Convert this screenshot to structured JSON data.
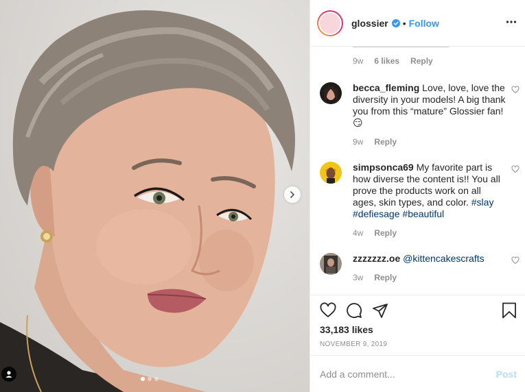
{
  "post": {
    "photo_description_icon": "portrait-photo",
    "carousel": {
      "current": 1,
      "total": 3
    }
  },
  "header": {
    "username": "glossier",
    "separator": "•",
    "follow_label": "Follow",
    "verified_icon": "verified-badge-icon",
    "more_icon": "more-options-icon"
  },
  "truncated_comment": {
    "time": "9w",
    "likes": "6 likes",
    "reply": "Reply"
  },
  "comments": [
    {
      "username": "becca_fleming",
      "text": "Love, love, love the diversity in your models! A big thank you from this “mature” Glossier fan! 😏",
      "time": "9w",
      "reply": "Reply"
    },
    {
      "username": "simpsonca69",
      "text": "My favorite part is how diverse the content is!! You all prove the products work on all ages, skin types, and color.",
      "tags": [
        "#slay",
        "#defiesage",
        "#beautiful"
      ],
      "time": "4w",
      "reply": "Reply"
    },
    {
      "username": "zzzzzzz.oe",
      "mention": "@kittencakescrafts",
      "time": "3w",
      "reply": "Reply"
    }
  ],
  "actions": {
    "likes": "33,183 likes",
    "date": "NOVEMBER 9, 2019",
    "icons": [
      "heart-icon",
      "comment-icon",
      "share-icon",
      "bookmark-icon"
    ]
  },
  "add_comment": {
    "placeholder": "Add a comment...",
    "post_label": "Post"
  },
  "colors": {
    "link": "#3897f0",
    "tag": "#00376b",
    "muted": "#8e8e8e",
    "post_disabled": "#b2dffc"
  }
}
